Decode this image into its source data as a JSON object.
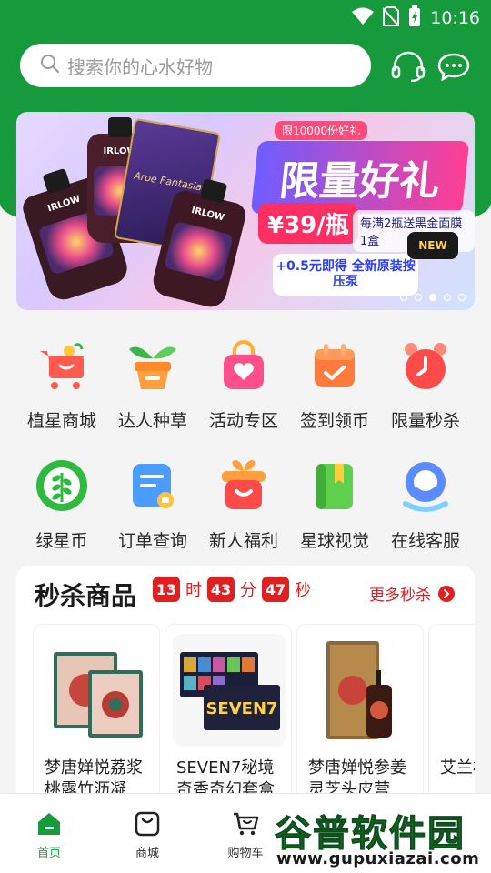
{
  "status": {
    "time": "10:16"
  },
  "search": {
    "placeholder": "搜索你的心水好物"
  },
  "header": {
    "icons": [
      "headset-icon",
      "chat-bubble-icon"
    ]
  },
  "banner": {
    "tag": "限10000份好礼",
    "title": "限量好礼",
    "price": "¥39/瓶",
    "sub": "每满2瓶送黑金面膜1盒",
    "note": "+0.5元即得 全新原装按压泵",
    "new_badge": "NEW",
    "product_brand": "IRLOW",
    "box_text": "Aroe Fantasia",
    "dots": 5,
    "active_dot": 3
  },
  "quick_menu": {
    "row1": [
      {
        "label": "植星商城",
        "icon": "cart-icon"
      },
      {
        "label": "达人种草",
        "icon": "plant-pot-icon"
      },
      {
        "label": "活动专区",
        "icon": "heart-bag-icon"
      },
      {
        "label": "签到领币",
        "icon": "calendar-check-icon"
      },
      {
        "label": "限量秒杀",
        "icon": "alarm-clock-icon"
      }
    ],
    "row2": [
      {
        "label": "绿星币",
        "icon": "leaf-coin-icon"
      },
      {
        "label": "订单查询",
        "icon": "order-doc-icon"
      },
      {
        "label": "新人福利",
        "icon": "gift-box-icon"
      },
      {
        "label": "星球视觉",
        "icon": "book-icon"
      },
      {
        "label": "在线客服",
        "icon": "customer-service-icon"
      }
    ]
  },
  "flash_sale": {
    "title": "秒杀商品",
    "hours": "13",
    "hours_unit": "时",
    "minutes": "43",
    "minutes_unit": "分",
    "seconds": "47",
    "seconds_unit": "秒",
    "more": "更多秒杀",
    "products": [
      {
        "name": "梦唐婵悦荔浆桃露竹沥凝"
      },
      {
        "name": "SEVEN7秘境奇香奇幻套盒"
      },
      {
        "name": "梦唐婵悦参姜灵芝头皮营"
      },
      {
        "name": "艾兰桃"
      }
    ]
  },
  "tabbar": {
    "tabs": [
      {
        "label": "首页",
        "icon": "home-icon"
      },
      {
        "label": "商城",
        "icon": "shopping-bag-icon"
      },
      {
        "label": "购物车",
        "icon": "shopping-cart-icon"
      }
    ],
    "active": 0
  },
  "watermark": {
    "logo": "谷普软件园",
    "url": "www.gupuxiazai.com"
  },
  "colors": {
    "brand_green": "#169a3c",
    "flash_red": "#e02020"
  }
}
